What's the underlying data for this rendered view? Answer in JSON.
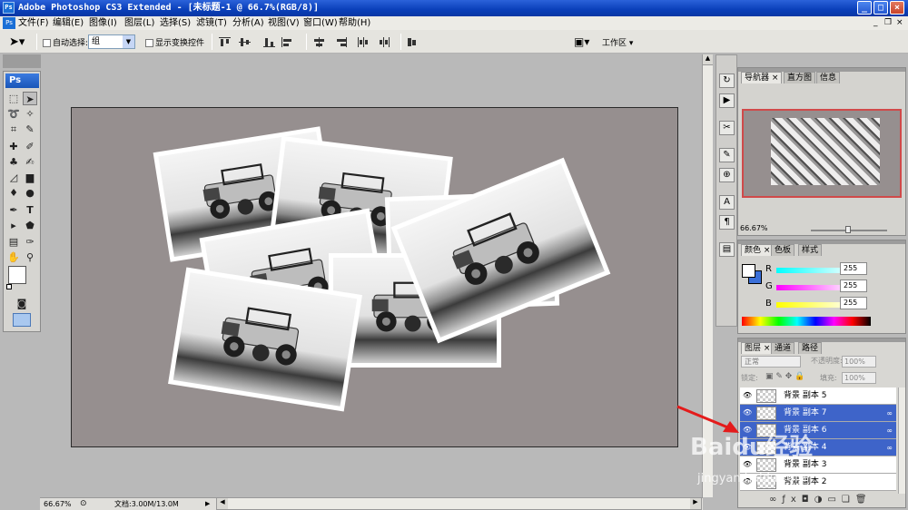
{
  "titlebar": {
    "title": "Adobe Photoshop CS3 Extended - [未标题-1 @ 66.7%(RGB/8)]",
    "icon": "ps-icon"
  },
  "menu": [
    "文件(F)",
    "编辑(E)",
    "图像(I)",
    "图层(L)",
    "选择(S)",
    "滤镜(T)",
    "分析(A)",
    "视图(V)",
    "窗口(W)",
    "帮助(H)"
  ],
  "options": {
    "auto_select_label": "自动选择:",
    "auto_select_value": "组",
    "show_transform_label": "显示变换控件",
    "workspace_label": "工作区"
  },
  "toolbox": {
    "logo": "Ps"
  },
  "status": {
    "zoom": "66.67%",
    "doc_info": "文档:3.00M/13.0M"
  },
  "navigator": {
    "tabs": [
      "导航器",
      "直方图",
      "信息"
    ],
    "zoom": "66.67%"
  },
  "color": {
    "tabs": [
      "颜色",
      "色板",
      "样式"
    ],
    "channels": [
      {
        "label": "R",
        "value": "255"
      },
      {
        "label": "G",
        "value": "255"
      },
      {
        "label": "B",
        "value": "255"
      }
    ]
  },
  "layers": {
    "tabs": [
      "图层",
      "通道",
      "路径"
    ],
    "blend_mode": "正常",
    "opacity_label": "不透明度:",
    "opacity_value": "100%",
    "lock_label": "锁定:",
    "fill_label": "填充:",
    "fill_value": "100%",
    "items": [
      {
        "name": "背景 副本 5",
        "selected": false
      },
      {
        "name": "背景 副本 7",
        "selected": true
      },
      {
        "name": "背景 副本 6",
        "selected": true
      },
      {
        "name": "背景 副本 4",
        "selected": true
      },
      {
        "name": "背景 副本 3",
        "selected": false
      },
      {
        "name": "背景 副本 2",
        "selected": false
      }
    ]
  },
  "watermark": {
    "text": "Baidu经验",
    "url": "jingyan.baidu.com"
  }
}
